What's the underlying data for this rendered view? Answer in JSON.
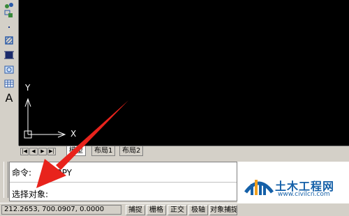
{
  "toolbar": {
    "tools": [
      {
        "icon": "point-cloud-icon"
      },
      {
        "icon": "block-insert-icon"
      },
      {
        "icon": "point-icon"
      },
      {
        "icon": "hatch-icon"
      },
      {
        "icon": "gradient-icon"
      },
      {
        "icon": "region-icon"
      },
      {
        "icon": "table-icon"
      },
      {
        "icon": "multiline-text-icon",
        "glyph": "A"
      }
    ]
  },
  "canvas": {
    "ucs": {
      "y_label": "Y",
      "x_label": "X"
    }
  },
  "layout_tabs": {
    "nav": [
      "|◀",
      "◀",
      "▶",
      "▶|"
    ],
    "tabs": [
      "模型",
      "布局1",
      "布局2"
    ],
    "active": "模型"
  },
  "command": {
    "line1_prompt": "命令:",
    "line1_command": "COPY",
    "line2": "选择对象:"
  },
  "status": {
    "coords": "212.2653,   700.0907,  0.0000",
    "toggles": [
      "捕捉",
      "栅格",
      "正交",
      "极轴",
      "对象捕捉"
    ]
  },
  "watermark": {
    "title": "土木工程网",
    "url": "www.civilcn.com"
  },
  "colors": {
    "canvas": "#000000",
    "ui": "#d4d0c8",
    "arrow": "#e8231c",
    "watermark": "#1560a8"
  }
}
